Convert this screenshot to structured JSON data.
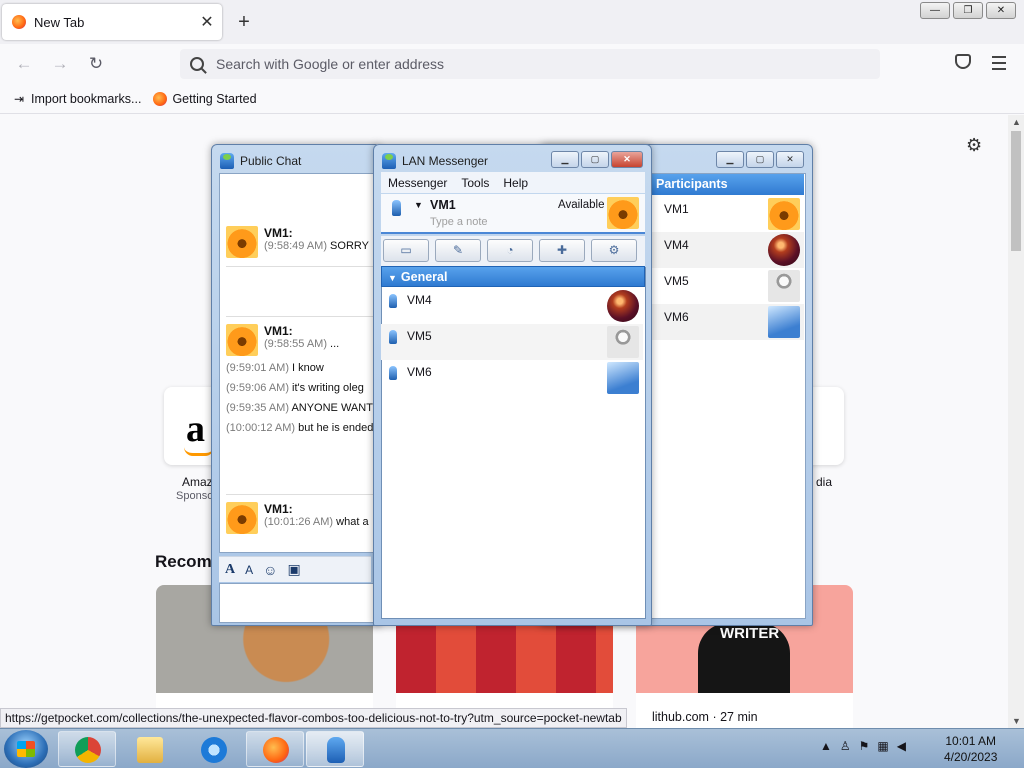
{
  "browser": {
    "tab_title": "New Tab",
    "tab_close": "✕",
    "new_tab": "+",
    "url_placeholder": "Search with Google or enter address",
    "bookmarks": [
      {
        "label": "Import bookmarks...",
        "icon": "import-icon"
      },
      {
        "label": "Getting Started",
        "icon": "firefox-icon"
      }
    ],
    "window_buttons": [
      "—",
      "❐",
      "✕"
    ]
  },
  "newtab": {
    "tiles": [
      {
        "label": "Amaz",
        "sub": "Sponso"
      },
      {
        "label": "dia",
        "sub": ""
      }
    ],
    "recommended_heading": "Recomm",
    "card_writer_text": "WRITER",
    "status_url": "https://getpocket.com/collections/the-unexpected-flavor-combos-too-delicious-not-to-try?utm_source=pocket-newtab",
    "card_source": "lithub.com · 27 min"
  },
  "public_chat": {
    "title": "Public Chat",
    "messages": [
      {
        "sender": "VM1:",
        "time": "(9:58:49 AM)",
        "text": "SORRY"
      },
      {
        "sender": "VM1:",
        "time": "(9:58:55 AM)",
        "text": "..."
      },
      {
        "time": "(9:59:01 AM)",
        "text": "I know"
      },
      {
        "time": "(9:59:06 AM)",
        "text": "it's writing oleg"
      },
      {
        "time": "(9:59:35 AM)",
        "text": "ANYONE WANT "
      },
      {
        "time": "(10:00:12 AM)",
        "text": "but he is ended"
      },
      {
        "sender": "VM1:",
        "time": "(10:01:26 AM)",
        "text": "what a"
      }
    ]
  },
  "lan_messenger": {
    "title": "LAN Messenger",
    "menu": [
      "Messenger",
      "Tools",
      "Help"
    ],
    "user_name": "VM1",
    "status": "Available",
    "note_placeholder": "Type a note",
    "group": "General",
    "contacts": [
      "VM4",
      "VM5",
      "VM6"
    ]
  },
  "participants": {
    "header": "Participants",
    "list": [
      "VM1",
      "VM4",
      "VM5",
      "VM6"
    ]
  },
  "taskbar": {
    "time": "10:01 AM",
    "date": "4/20/2023"
  },
  "colors": {
    "selection_blue": "#3f8ae0",
    "firefox_orange": "#ff6611"
  }
}
